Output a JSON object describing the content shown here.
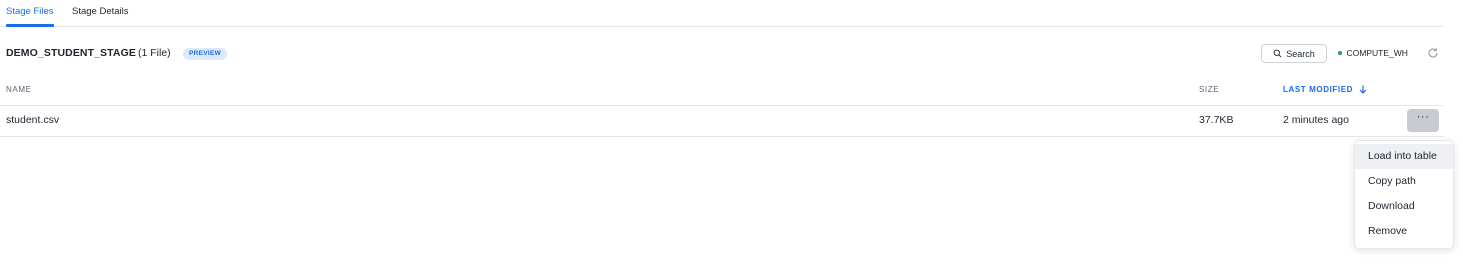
{
  "tabs": [
    {
      "label": "Stage Files",
      "active": true
    },
    {
      "label": "Stage Details",
      "active": false
    }
  ],
  "header": {
    "stage_name": "DEMO_STUDENT_STAGE",
    "file_count": "(1 File)",
    "badge": "PREVIEW",
    "search_label": "Search",
    "warehouse": "COMPUTE_WH"
  },
  "table": {
    "columns": [
      "NAME",
      "SIZE",
      "LAST MODIFIED"
    ],
    "sorted_column": "LAST MODIFIED",
    "sort_direction": "descending",
    "rows": [
      {
        "name": "student.csv",
        "size": "37.7KB",
        "modified": "2 minutes ago",
        "action": "···"
      }
    ]
  },
  "context_menu": {
    "items": [
      "Load into table",
      "Copy path",
      "Download",
      "Remove"
    ],
    "highlighted": "Load into table"
  },
  "colors": {
    "accent": "#1a6ce7",
    "warehouse_status": "#2e9e6a",
    "badge_bg": "#dce9fb"
  },
  "icons": [
    "search-icon",
    "refresh-icon",
    "sort-down-arrow-icon",
    "more-options-icon"
  ]
}
